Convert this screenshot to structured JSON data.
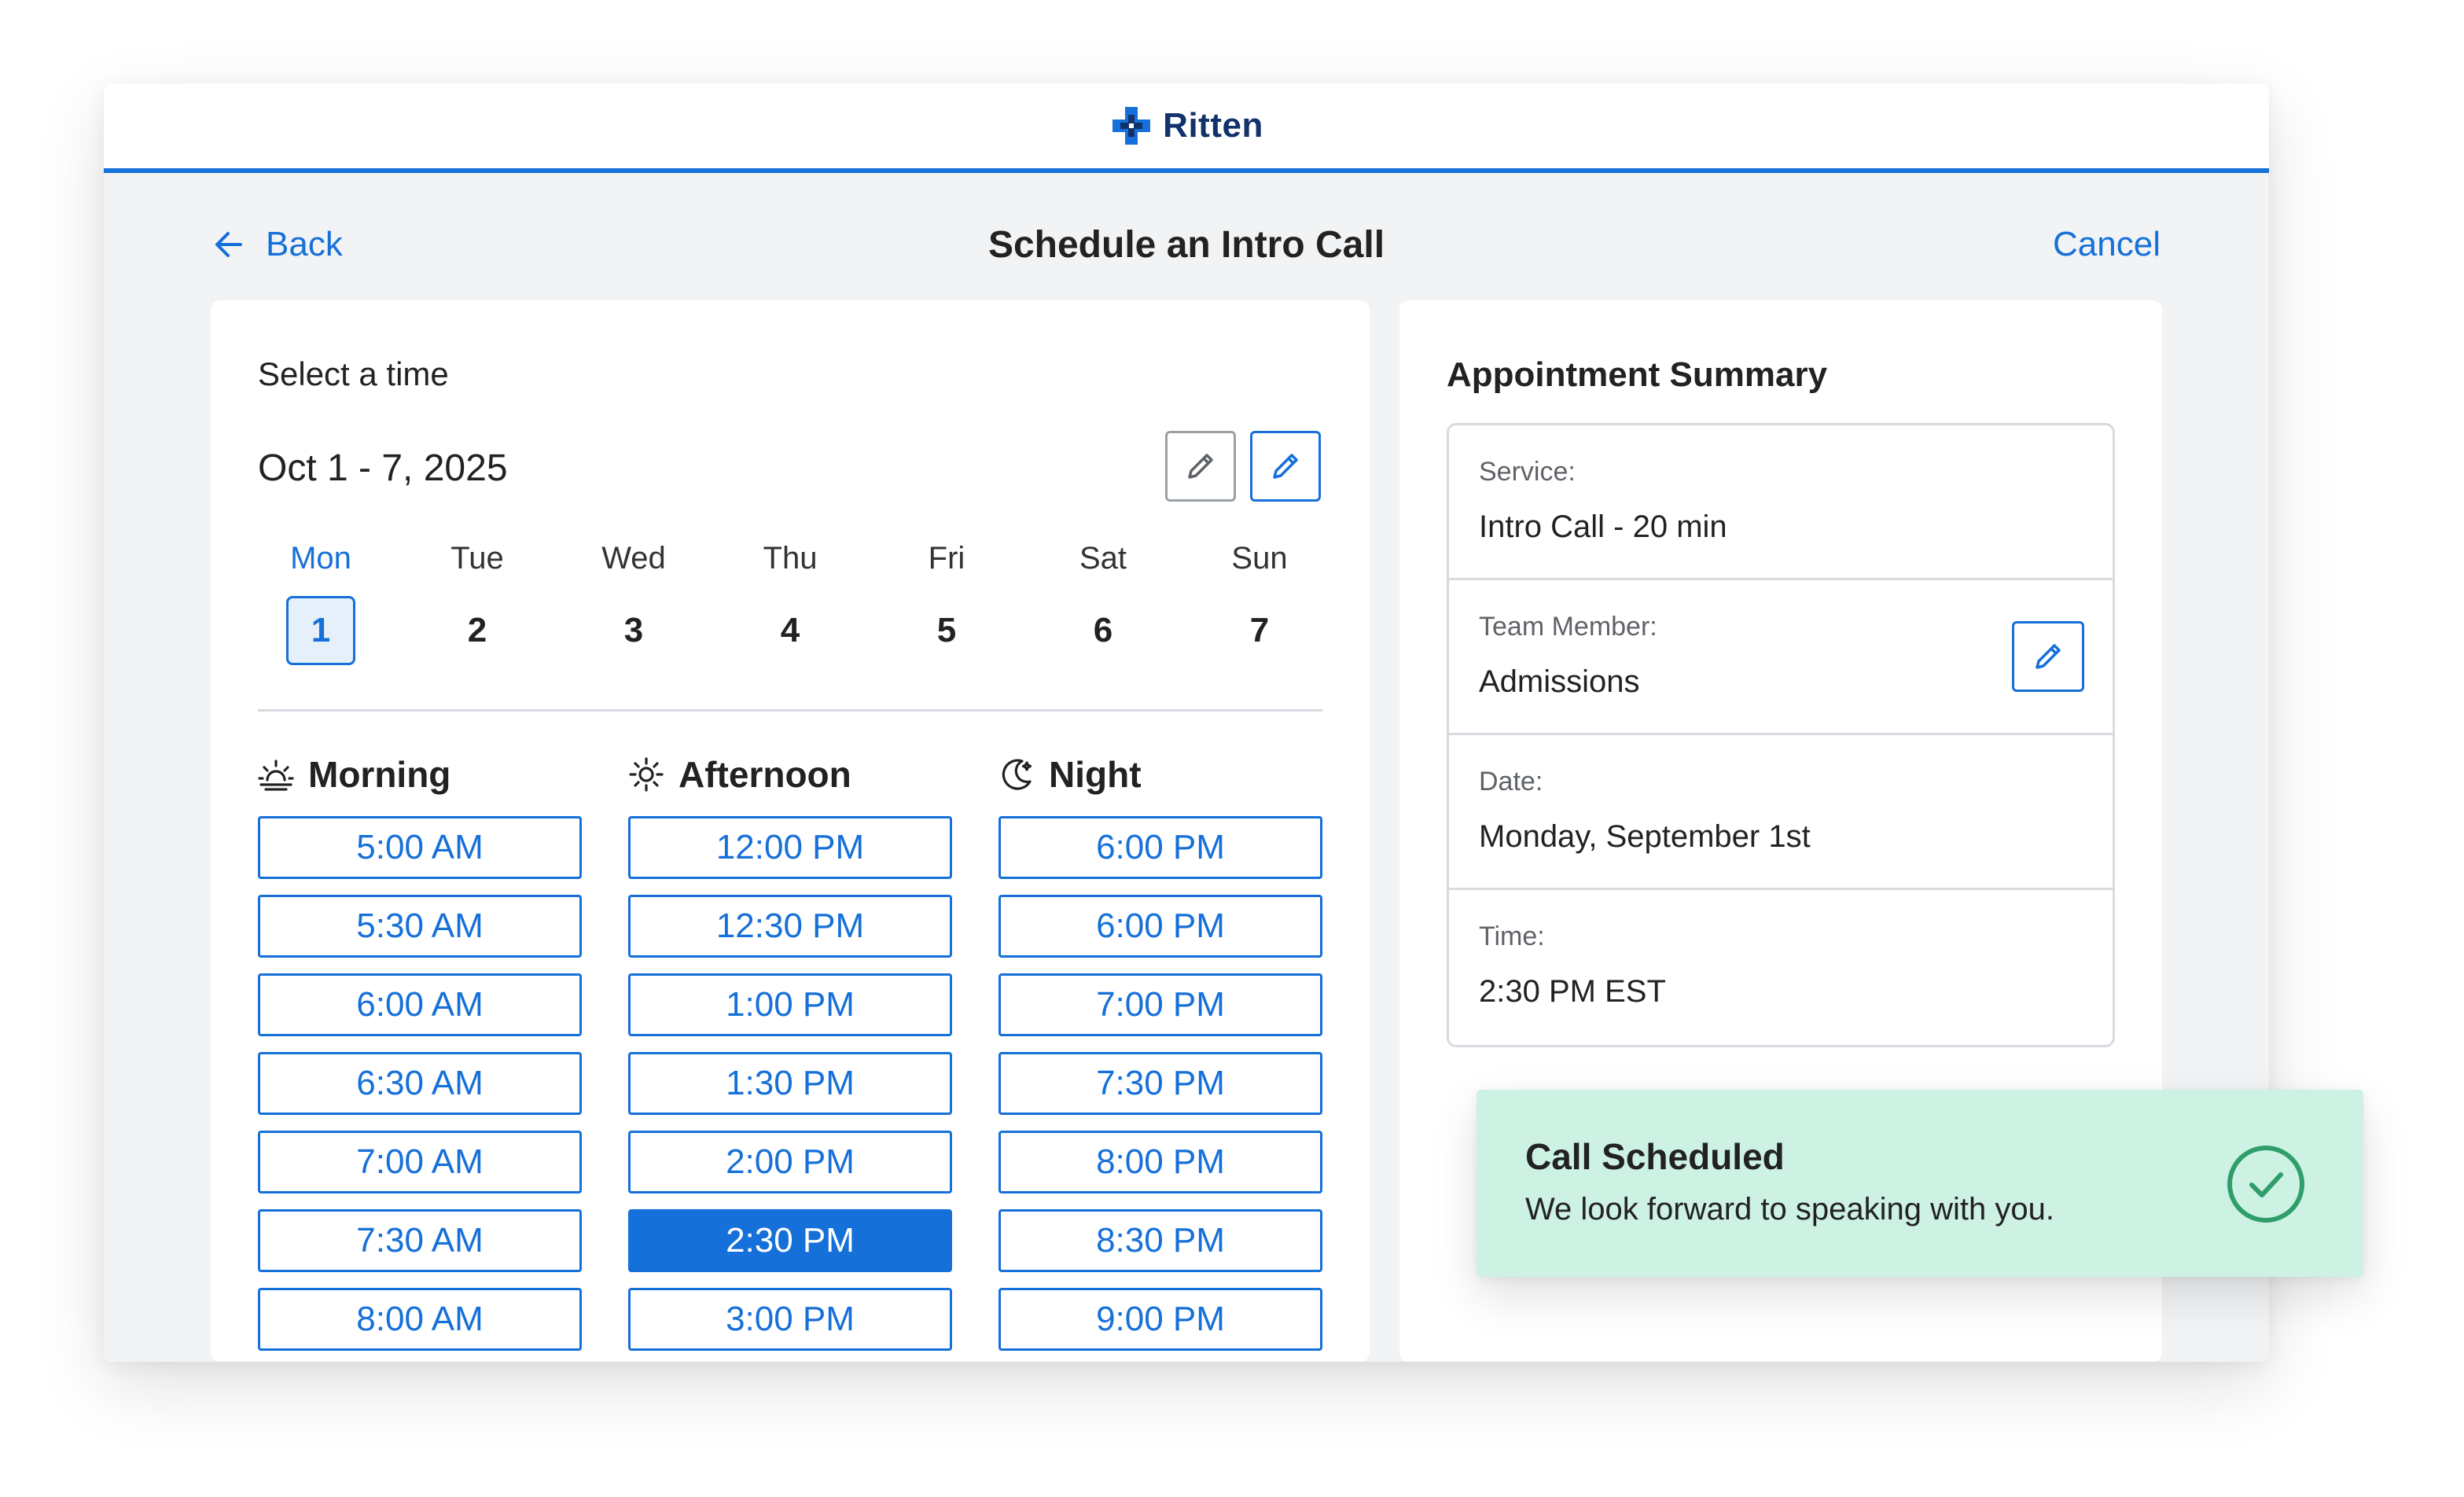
{
  "brand": {
    "name": "Ritten",
    "accent": "#1670d9",
    "navy": "#12326b",
    "success": "#2f9e6b"
  },
  "nav": {
    "back_label": "Back",
    "title": "Schedule an Intro Call",
    "cancel_label": "Cancel"
  },
  "picker": {
    "section_label": "Select a time",
    "range": "Oct 1 - 7, 2025",
    "days": [
      {
        "name": "Mon",
        "num": "1",
        "selected": true
      },
      {
        "name": "Tue",
        "num": "2"
      },
      {
        "name": "Wed",
        "num": "3"
      },
      {
        "name": "Thu",
        "num": "4"
      },
      {
        "name": "Fri",
        "num": "5"
      },
      {
        "name": "Sat",
        "num": "6"
      },
      {
        "name": "Sun",
        "num": "7"
      }
    ],
    "groups": [
      {
        "label": "Morning",
        "icon": "sunrise-icon",
        "slots": [
          "5:00 AM",
          "5:30 AM",
          "6:00 AM",
          "6:30 AM",
          "7:00 AM",
          "7:30 AM",
          "8:00 AM"
        ]
      },
      {
        "label": "Afternoon",
        "icon": "sun-icon",
        "slots": [
          "12:00 PM",
          "12:30 PM",
          "1:00 PM",
          "1:30 PM",
          "2:00 PM",
          "2:30 PM",
          "3:00 PM"
        ]
      },
      {
        "label": "Night",
        "icon": "moon-icon",
        "slots": [
          "6:00 PM",
          "6:00 PM",
          "7:00 PM",
          "7:30 PM",
          "8:00 PM",
          "8:30 PM",
          "9:00 PM"
        ]
      }
    ],
    "selected_slot": "2:30 PM"
  },
  "summary": {
    "title": "Appointment Summary",
    "rows": [
      {
        "label": "Service:",
        "value": "Intro Call - 20 min"
      },
      {
        "label": "Team Member:",
        "value": "Admissions"
      },
      {
        "label": "Date:",
        "value": "Monday, September 1st"
      },
      {
        "label": "Time:",
        "value": "2:30 PM EST"
      }
    ]
  },
  "toast": {
    "title": "Call Scheduled",
    "message": "We look forward to speaking with you.",
    "icon": "check-circle-icon"
  }
}
